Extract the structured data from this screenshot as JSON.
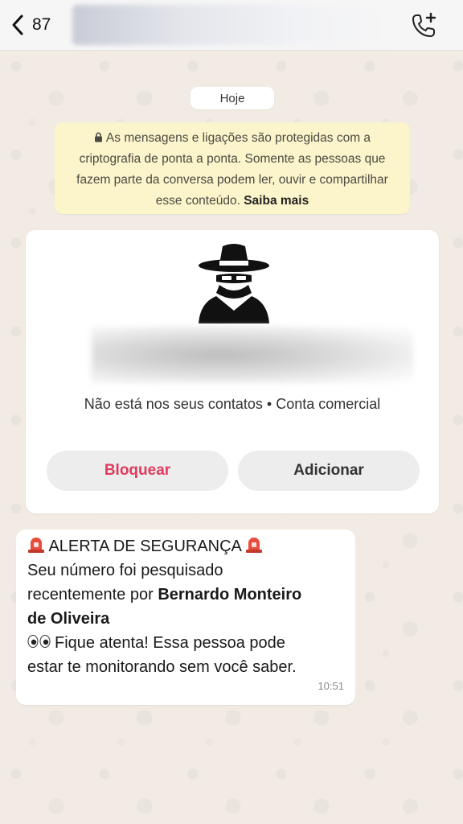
{
  "header": {
    "back_count": "87",
    "icons": {
      "back": "chevron-left-icon",
      "call": "add-call-icon"
    }
  },
  "chat": {
    "date_label": "Hoje",
    "encryption_notice": {
      "text": "As mensagens e ligações são protegidas com a criptografia de ponta a ponta. Somente as pessoas que fazem parte da conversa podem ler, ouvir e compartilhar esse conteúdo.",
      "link": "Saiba mais"
    },
    "business_card": {
      "status": "Não está nos seus contatos • Conta comercial",
      "block_label": "Bloquear",
      "add_label": "Adicionar"
    },
    "message": {
      "alert_title": "ALERTA DE SEGURANÇA",
      "line1": "Seu número foi pesquisado",
      "line2_prefix": "recentemente por ",
      "name_part1": "Bernardo Monteiro",
      "name_part2": "de Oliveira",
      "line4": "Fique atenta! Essa pessoa pode",
      "line5": "estar te monitorando sem você saber.",
      "time": "10:51"
    }
  },
  "colors": {
    "block": "#e03b5e",
    "notice_bg": "#fcf4cb",
    "chat_bg": "#f1ebe3"
  }
}
